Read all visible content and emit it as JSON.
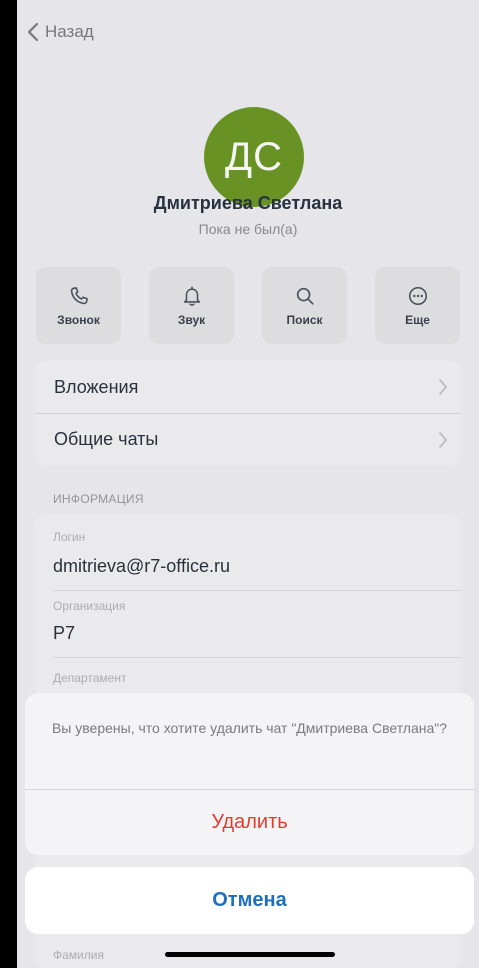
{
  "nav": {
    "back_label": "Назад"
  },
  "contact": {
    "initials": "ДС",
    "name": "Дмитриева Светлана",
    "status": "Пока не был(а)",
    "avatar_color": "#6d9a26"
  },
  "actions": [
    {
      "label": "Звонок",
      "icon": "phone-icon"
    },
    {
      "label": "Звук",
      "icon": "bell-icon"
    },
    {
      "label": "Поиск",
      "icon": "search-icon"
    },
    {
      "label": "Еще",
      "icon": "more-icon"
    }
  ],
  "menu": [
    {
      "label": "Вложения"
    },
    {
      "label": "Общие чаты"
    }
  ],
  "info": {
    "header": "ИНФОРМАЦИЯ",
    "fields": [
      {
        "label": "Логин",
        "value": "dmitrieva@r7-office.ru"
      },
      {
        "label": "Организация",
        "value": "Р7"
      },
      {
        "label": "Департамент",
        "value": ""
      },
      {
        "label": "Фамилия",
        "value": ""
      }
    ]
  },
  "dialog": {
    "message": "Вы уверены, что хотите удалить чат \"Дмитриева Светлана\"?",
    "delete_label": "Удалить",
    "cancel_label": "Отмена",
    "delete_color": "#e8392e",
    "cancel_color": "#1f6fbf"
  }
}
